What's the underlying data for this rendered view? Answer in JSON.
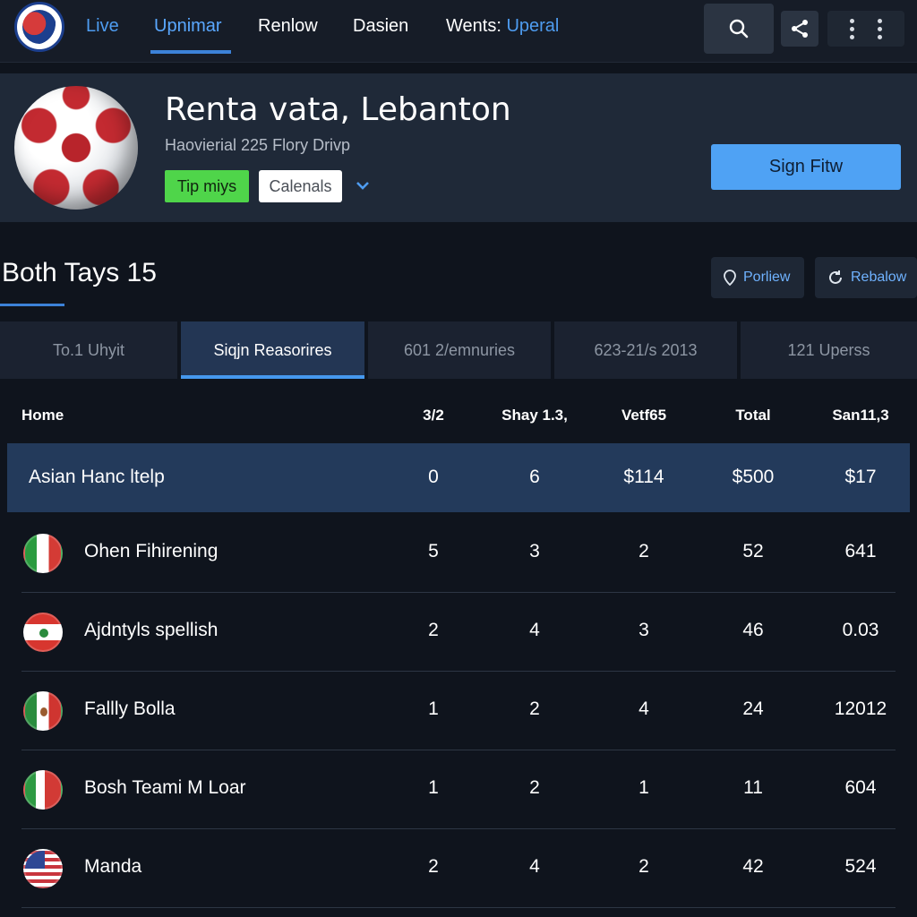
{
  "nav": {
    "items": [
      "Live",
      "Upnimar",
      "Renlow",
      "Dasien"
    ],
    "wents_label": "Wents:",
    "wents_accent": "Uperal",
    "search_icon": "search-icon",
    "share_icon": "share-icon",
    "more_icon": "more-icon"
  },
  "hero": {
    "title": "Renta vata, Lebanton",
    "subtitle": "Haovierial 225 Flory Drivp",
    "tag_green": "Tip miys",
    "tag_white": "Calenals",
    "sign_button": "Sign Fitw"
  },
  "section": {
    "title": "Both  Tays 15",
    "pill_left": "Porliew",
    "pill_right": "Rebalow"
  },
  "tabs": [
    "To.1 Uhyit",
    "Siqjn Reasorires",
    "601 2/emnuries",
    "623-21/s 2013",
    "121 Uperss"
  ],
  "table": {
    "headers": [
      "Home",
      "3/2",
      "Shay 1.3,",
      "Vetf65",
      "Total",
      "San11,3"
    ],
    "highlight": {
      "name": "Asian Hanc ltelp",
      "c1": "0",
      "c2": "6",
      "c3": "$114",
      "c4": "$500",
      "c5": "$17"
    },
    "rows": [
      {
        "name": "Ohen Fihirening",
        "c1": "5",
        "c2": "3",
        "c3": "2",
        "c4": "52",
        "c5": "641"
      },
      {
        "name": "Ajdntyls spellish",
        "c1": "2",
        "c2": "4",
        "c3": "3",
        "c4": "46",
        "c5": "0.03"
      },
      {
        "name": "Fallly Bolla",
        "c1": "1",
        "c2": "2",
        "c3": "4",
        "c4": "24",
        "c5": "12012"
      },
      {
        "name": "Bosh Teami M Loar",
        "c1": "1",
        "c2": "2",
        "c3": "1",
        "c4": "11",
        "c5": "604"
      },
      {
        "name": "Manda",
        "c1": "2",
        "c2": "4",
        "c3": "2",
        "c4": "42",
        "c5": "524"
      }
    ]
  },
  "colors": {
    "accent": "#4e9cf0",
    "green_tag": "#4fd54a",
    "highlight_row": "#233a5b",
    "sign_button": "#4fa2f4"
  }
}
